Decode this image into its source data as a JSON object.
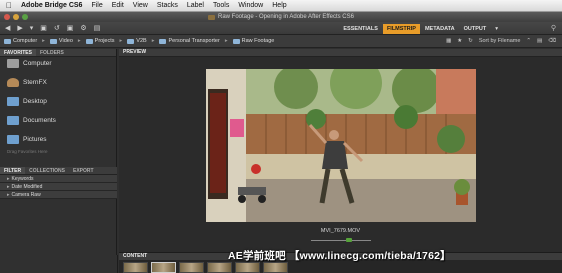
{
  "menubar": {
    "app": "Adobe Bridge CS6",
    "items": [
      "File",
      "Edit",
      "View",
      "Stacks",
      "Label",
      "Tools",
      "Window",
      "Help"
    ]
  },
  "window": {
    "title": "Raw Footage - Opening in Adobe After Effects CS6"
  },
  "toolbar": {
    "workspaces": [
      "ESSENTIALS",
      "FILMSTRIP",
      "METADATA",
      "OUTPUT"
    ],
    "active_workspace": "FILMSTRIP"
  },
  "path": {
    "crumbs": [
      "Computer",
      "Video",
      "Projects",
      "V2B",
      "Personal Transporter",
      "Raw Footage"
    ],
    "sort_label": "Sort by Filename"
  },
  "left_panel": {
    "tabs": [
      "FAVORITES",
      "FOLDERS"
    ],
    "favorites": [
      {
        "label": "Computer",
        "icon": "computer-icon"
      },
      {
        "label": "SternFX",
        "icon": "user-icon"
      },
      {
        "label": "Desktop",
        "icon": "folder-icon"
      },
      {
        "label": "Documents",
        "icon": "folder-icon"
      },
      {
        "label": "Pictures",
        "icon": "folder-icon"
      }
    ],
    "drag_note": "Drag Favorites Here",
    "filter_tabs": [
      "FILTER",
      "COLLECTIONS",
      "EXPORT"
    ],
    "filter_rows": [
      "Keywords",
      "Date Modified",
      "Camera Raw"
    ]
  },
  "preview": {
    "header": "PREVIEW",
    "filename": "MVI_7679.MOV"
  },
  "content": {
    "header": "CONTENT"
  },
  "watermark": "AE学前班吧 【www.linecg.com/tieba/1762】",
  "colors": {
    "accent": "#e89c29",
    "panel": "#303030",
    "playhead": "#56a33a"
  }
}
